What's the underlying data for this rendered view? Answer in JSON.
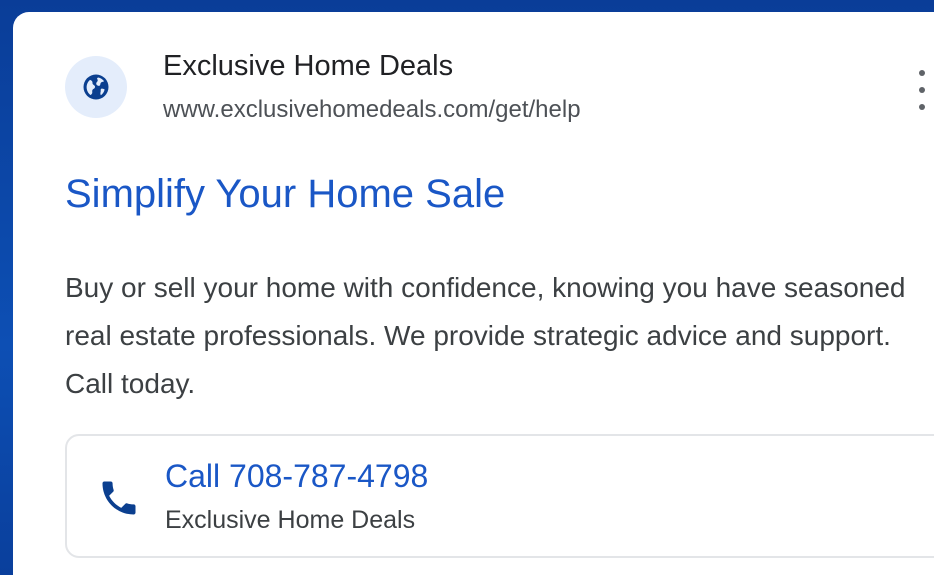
{
  "ad": {
    "site_name": "Exclusive Home Deals",
    "display_url": "www.exclusivehomedeals.com/get/help",
    "headline": "Simplify Your Home Sale",
    "description": "Buy or sell your home with confidence, knowing you have seasoned real estate professionals. We provide strategic advice and support. Call today.",
    "favicon_icon": "globe-icon",
    "menu_icon": "more-vert-icon"
  },
  "call_extension": {
    "label": "Call 708-787-4798",
    "business_name": "Exclusive Home Deals",
    "icon": "phone-icon"
  },
  "colors": {
    "link_blue": "#1a57c6",
    "background_blue": "#0b46a6",
    "favicon_bg": "#e4edfb",
    "icon_blue": "#0b3f8f"
  }
}
